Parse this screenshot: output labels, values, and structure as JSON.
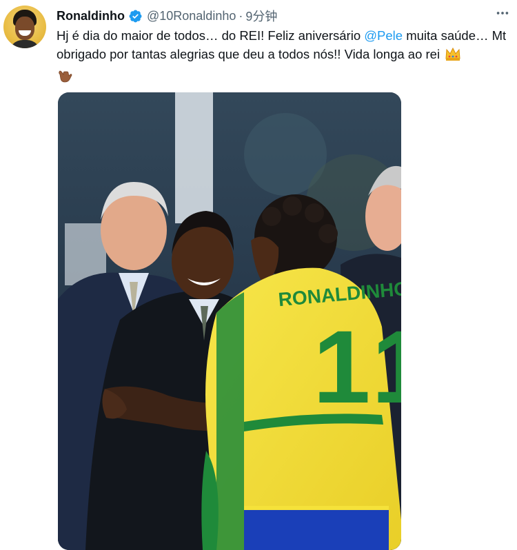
{
  "tweet": {
    "author": {
      "name": "Ronaldinho",
      "handle": "@10Ronaldinho",
      "verified": true
    },
    "separator": "·",
    "time": "9分钟",
    "more_icon": "more-horizontal-icon",
    "text": {
      "part1": "Hj é dia do maior de todos… do REI! Feliz aniversário ",
      "mention": "@Pele",
      "part2": " muita saúde… Mt obrigado por tantas alegrias que deu a todos nós!! Vida longa ao rei",
      "emoji_1": "crown-emoji",
      "emoji_2": "call-me-hand-emoji"
    },
    "media": {
      "jersey_name": "RONALDINHO",
      "jersey_number": "11"
    }
  },
  "colors": {
    "link": "#1d9bf0",
    "verified": "#1d9bf0",
    "secondary_text": "#536471",
    "jersey_yellow": "#f5e23a",
    "jersey_green": "#1f8a3a"
  }
}
